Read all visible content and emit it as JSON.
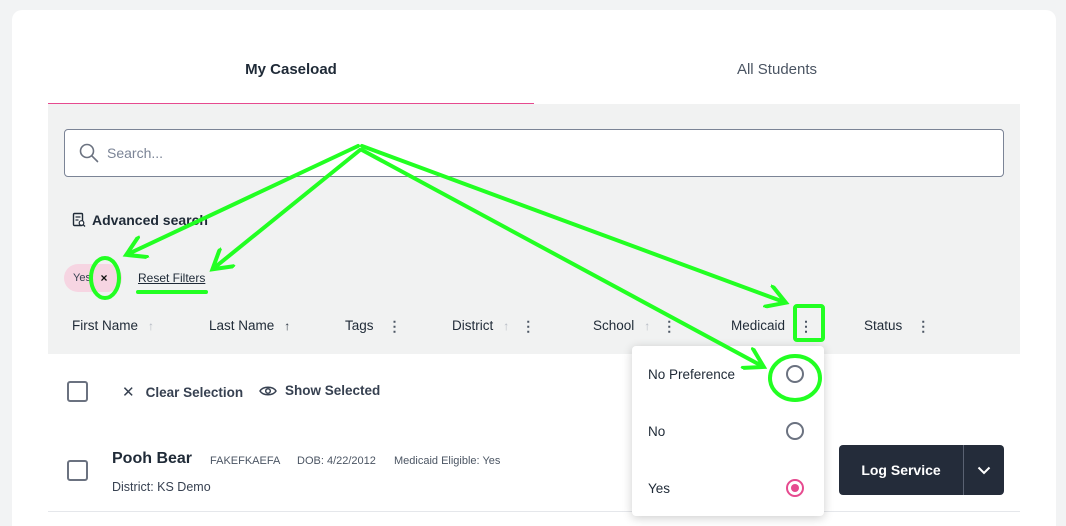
{
  "tabs": [
    {
      "label": "My Caseload"
    },
    {
      "label": "All Students"
    }
  ],
  "search": {
    "placeholder": "Search..."
  },
  "advanced_search": {
    "label": "Advanced search"
  },
  "filters": {
    "chip_label": "Yes",
    "chip_remove_glyph": "×",
    "reset_label": "Reset Filters"
  },
  "columns": [
    {
      "label": "First Name",
      "sort": "up-dim"
    },
    {
      "label": "Last Name",
      "sort": "up-dark"
    },
    {
      "label": "Tags",
      "menu": true
    },
    {
      "label": "District",
      "sort": "up-dim",
      "menu": true
    },
    {
      "label": "School",
      "sort": "up-dim",
      "menu": true
    },
    {
      "label": "Medicaid",
      "menu": true
    },
    {
      "label": "Status",
      "menu": true
    }
  ],
  "selection": {
    "clear_label": "Clear Selection",
    "show_label": "Show Selected"
  },
  "student": {
    "name": "Pooh Bear",
    "id": "FAKEFKAEFA",
    "dob": "DOB: 4/22/2012",
    "medicaid": "Medicaid Eligible: Yes",
    "district_label": "District:",
    "district_value": "KS Demo",
    "log_service_label": "Log Service"
  },
  "medicaid_menu": {
    "options": [
      {
        "label": "No Preference",
        "selected": false
      },
      {
        "label": "No",
        "selected": false
      },
      {
        "label": "Yes",
        "selected": true
      }
    ]
  },
  "colors": {
    "accent": "#e64a8f",
    "annotation": "#22ff22",
    "button_dark": "#242c3a"
  }
}
